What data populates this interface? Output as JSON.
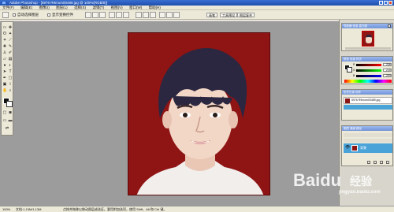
{
  "window": {
    "title": "Adobe Photoshop - [5976 R9mom00489.jpg @ 100%(RGB/8)]"
  },
  "menu": [
    "文件(F)",
    "编辑(E)",
    "图像(I)",
    "图层(L)",
    "选择(S)",
    "滤镜(T)",
    "视图(V)",
    "窗口(W)",
    "帮助(H)"
  ],
  "options": {
    "auto_select_label": "自动选择图层",
    "show_transform_label": "显示变换控件"
  },
  "palette_tabs": [
    "画笔",
    "工具预设",
    "图层复合"
  ],
  "navigator": {
    "title": "导航器 信息 直方图"
  },
  "color_panel": {
    "title": "颜色 色板 样式",
    "r_label": "R",
    "g_label": "G",
    "b_label": "B",
    "r_value": "236",
    "g_value": "210",
    "b_value": "209"
  },
  "history": {
    "title": "历史记录 动作",
    "item": "5976 R9mom00489.jpg"
  },
  "layers": {
    "title": "图层 通道 路径",
    "layer_name": "背景"
  },
  "status": {
    "zoom": "100%",
    "doc_size": "文档:1.13M/1.13M",
    "hint": "点按并拖移以移动图层或选区。要用附加选项，使用 Shift、Alt 和 Ctrl 键。"
  },
  "watermark": {
    "brand": "Baidu",
    "brand_cn": "经验",
    "url": "jingyan.baidu.com"
  },
  "colors": {
    "background_red": "#8f1414",
    "title_blue": "#1f4fae",
    "layer_highlight": "#4aa3d8"
  }
}
